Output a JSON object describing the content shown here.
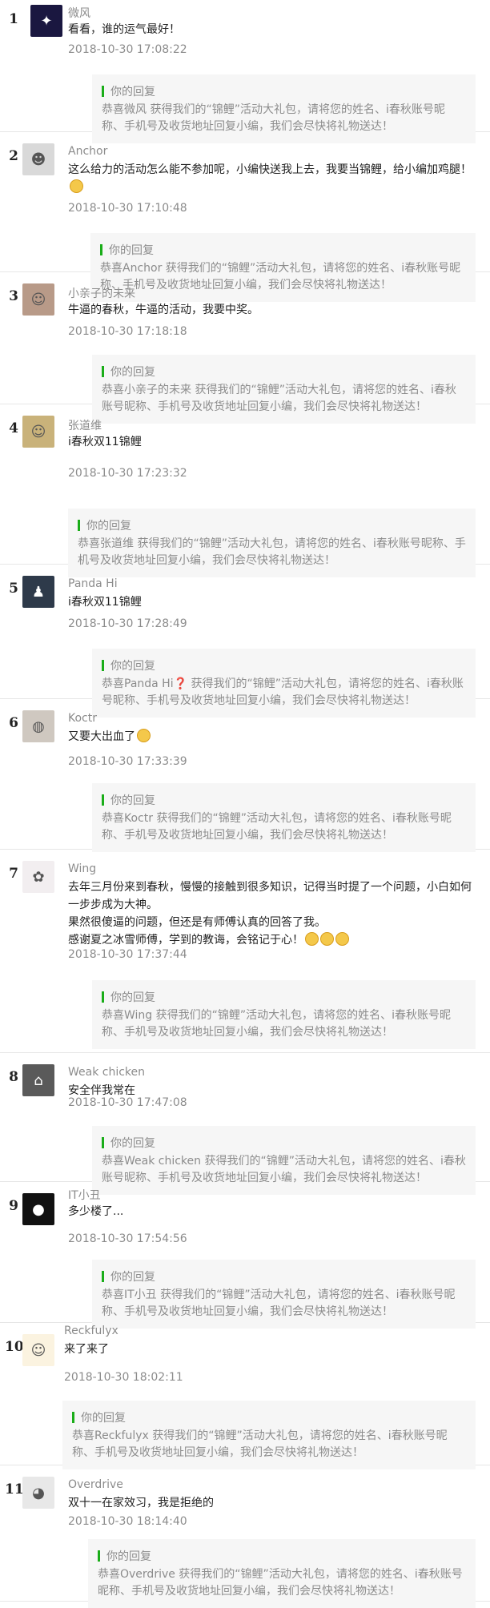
{
  "comments": [
    {
      "rank": "1",
      "name": "微风",
      "text": "看看，谁的运气最好！",
      "time": "2018-10-30 17:08:22",
      "reply_label": "你的回复",
      "reply_text": "恭喜微风 获得我们的“锦鲤”活动大礼包，请将您的姓名、i春秋账号昵称、手机号及收货地址回复小编，我们会尽快将礼物送达！",
      "avatar_icon": "galaxy-avatar-icon",
      "avatar_bg": "#1a1740",
      "avatar_glyph": "✦"
    },
    {
      "rank": "2",
      "name": "Anchor",
      "text": "这么给力的活动怎么能不参加呢，小编快送我上去，我要当锦鲤，给小编加鸡腿！",
      "emoji": "face",
      "time": "2018-10-30 17:10:48",
      "reply_label": "你的回复",
      "reply_text": "恭喜Anchor 获得我们的“锦鲤”活动大礼包，请将您的姓名、i春秋账号昵称、手机号及收货地址回复小编，我们会尽快将礼物送达！",
      "avatar_icon": "face-sketch-avatar-icon",
      "avatar_bg": "#d9d9d9",
      "avatar_glyph": "☻"
    },
    {
      "rank": "3",
      "name": "小亲子的未来",
      "text": "牛逼的春秋，牛逼的活动，我要中奖。",
      "time": "2018-10-30 17:18:18",
      "reply_label": "你的回复",
      "reply_text": "恭喜小亲子的未来 获得我们的“锦鲤”活动大礼包，请将您的姓名、i春秋账号昵称、手机号及收货地址回复小编，我们会尽快将礼物送达！",
      "avatar_icon": "person-photo-avatar-icon",
      "avatar_bg": "#b89a88",
      "avatar_glyph": "☺"
    },
    {
      "rank": "4",
      "name": "张道维",
      "text": "i春秋双11锦鲤",
      "time": "2018-10-30 17:23:32",
      "reply_label": "你的回复",
      "reply_text": "恭喜张道维 获得我们的“锦鲤”活动大礼包，请将您的姓名、i春秋账号昵称、手机号及收货地址回复小编，我们会尽快将礼物送达！",
      "avatar_icon": "person-photo-avatar-icon",
      "avatar_bg": "#c9b27a",
      "avatar_glyph": "☺"
    },
    {
      "rank": "5",
      "name": "Panda Hi",
      "text": "i春秋双11锦鲤",
      "time": "2018-10-30 17:28:49",
      "reply_label": "你的回复",
      "reply_text": "恭喜Panda Hi❓ 获得我们的“锦鲤”活动大礼包，请将您的姓名、i春秋账号昵称、手机号及收货地址回复小编，我们会尽快将礼物送达！",
      "avatar_icon": "silhouette-avatar-icon",
      "avatar_bg": "#2e3a4a",
      "avatar_glyph": "♟"
    },
    {
      "rank": "6",
      "name": "Koctr",
      "text": "又要大出血了",
      "emoji": "face",
      "time": "2018-10-30 17:33:39",
      "reply_label": "你的回复",
      "reply_text": "恭喜Koctr 获得我们的“锦鲤”活动大礼包，请将您的姓名、i春秋账号昵称、手机号及收货地址回复小编，我们会尽快将礼物送达！",
      "avatar_icon": "food-photo-avatar-icon",
      "avatar_bg": "#cfc8c0",
      "avatar_glyph": "◍"
    },
    {
      "rank": "7",
      "name": "Wing",
      "text": "去年三月份来到春秋，慢慢的接触到很多知识，记得当时提了一个问题，小白如何一步步成为大神。\n果然很傻逼的问题，但还是有师傅认真的回答了我。\n感谢夏之冰雪师傅，学到的教诲，会铭记于心！",
      "emoji": "face3",
      "time": "2018-10-30 17:37:44",
      "reply_label": "你的回复",
      "reply_text": "恭喜Wing 获得我们的“锦鲤”活动大礼包，请将您的姓名、i春秋账号昵称、手机号及收货地址回复小编，我们会尽快将礼物送达！",
      "avatar_icon": "cartoon-avatar-icon",
      "avatar_bg": "#f2eef0",
      "avatar_glyph": "✿"
    },
    {
      "rank": "8",
      "name": "Weak chicken",
      "text": "安全伴我常在",
      "time": "2018-10-30 17:47:08",
      "reply_label": "你的回复",
      "reply_text": "恭喜Weak chicken 获得我们的“锦鲤”活动大礼包，请将您的姓名、i春秋账号昵称、手机号及收货地址回复小编，我们会尽快将礼物送达！",
      "avatar_icon": "badge-avatar-icon",
      "avatar_bg": "#5a5a5a",
      "avatar_glyph": "⌂"
    },
    {
      "rank": "9",
      "name": "IT小丑",
      "text": "多少楼了...",
      "time": "2018-10-30 17:54:56",
      "reply_label": "你的回复",
      "reply_text": "恭喜IT小丑 获得我们的“锦鲤”活动大礼包，请将您的姓名、i春秋账号昵称、手机号及收货地址回复小编，我们会尽快将礼物送达！",
      "avatar_icon": "mouse-logo-avatar-icon",
      "avatar_bg": "#111111",
      "avatar_glyph": "●"
    },
    {
      "rank": "10",
      "name": "Reckfulyx",
      "text": "来了来了",
      "time": "2018-10-30 18:02:11",
      "reply_label": "你的回复",
      "reply_text": "恭喜Reckfulyx 获得我们的“锦鲤”活动大礼包，请将您的姓名、i春秋账号昵称、手机号及收货地址回复小编，我们会尽快将礼物送达！",
      "avatar_icon": "cartoon-avatar-icon",
      "avatar_bg": "#fbf3e0",
      "avatar_glyph": "☺"
    },
    {
      "rank": "11",
      "name": "Overdrive",
      "text": "双十一在家效习，我是拒绝的",
      "time": "2018-10-30 18:14:40",
      "reply_label": "你的回复",
      "reply_text": "恭喜Overdrive 获得我们的“锦鲤”活动大礼包，请将您的姓名、i春秋账号昵称、手机号及收货地址回复小编，我们会尽快将礼物送达！",
      "avatar_icon": "cartoon-avatar-icon",
      "avatar_bg": "#e8e8e8",
      "avatar_glyph": "◕"
    }
  ]
}
